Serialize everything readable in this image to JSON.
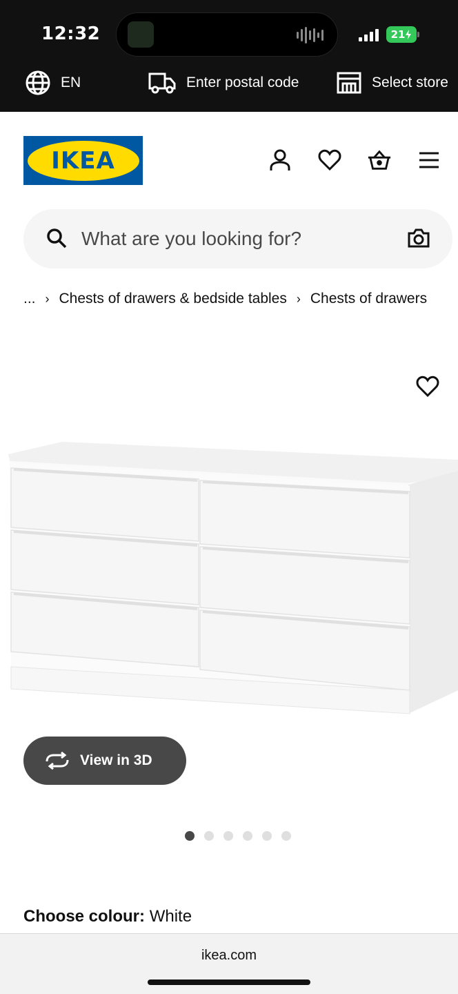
{
  "status_bar": {
    "time": "12:32",
    "battery": "21"
  },
  "utility_bar": {
    "language": "EN",
    "postal_code": "Enter postal code",
    "store": "Select store"
  },
  "header": {
    "logo_text": "IKEA",
    "icons": [
      "profile-icon",
      "heart-icon",
      "basket-icon",
      "menu-icon"
    ]
  },
  "search": {
    "placeholder": "What are you looking for?"
  },
  "breadcrumb": {
    "items": [
      "...",
      "Chests of drawers & bedside tables",
      "Chests of drawers"
    ]
  },
  "product": {
    "view_3d_label": "View in 3D",
    "carousel": {
      "total": 6,
      "active": 1
    },
    "colour_label": "Choose colour:",
    "colour_value": "White"
  },
  "browser": {
    "url": "ikea.com"
  },
  "colors": {
    "ikea_blue": "#0058a3",
    "ikea_yellow": "#ffdb00",
    "dark_button": "#484848",
    "battery_green": "#34c759"
  }
}
